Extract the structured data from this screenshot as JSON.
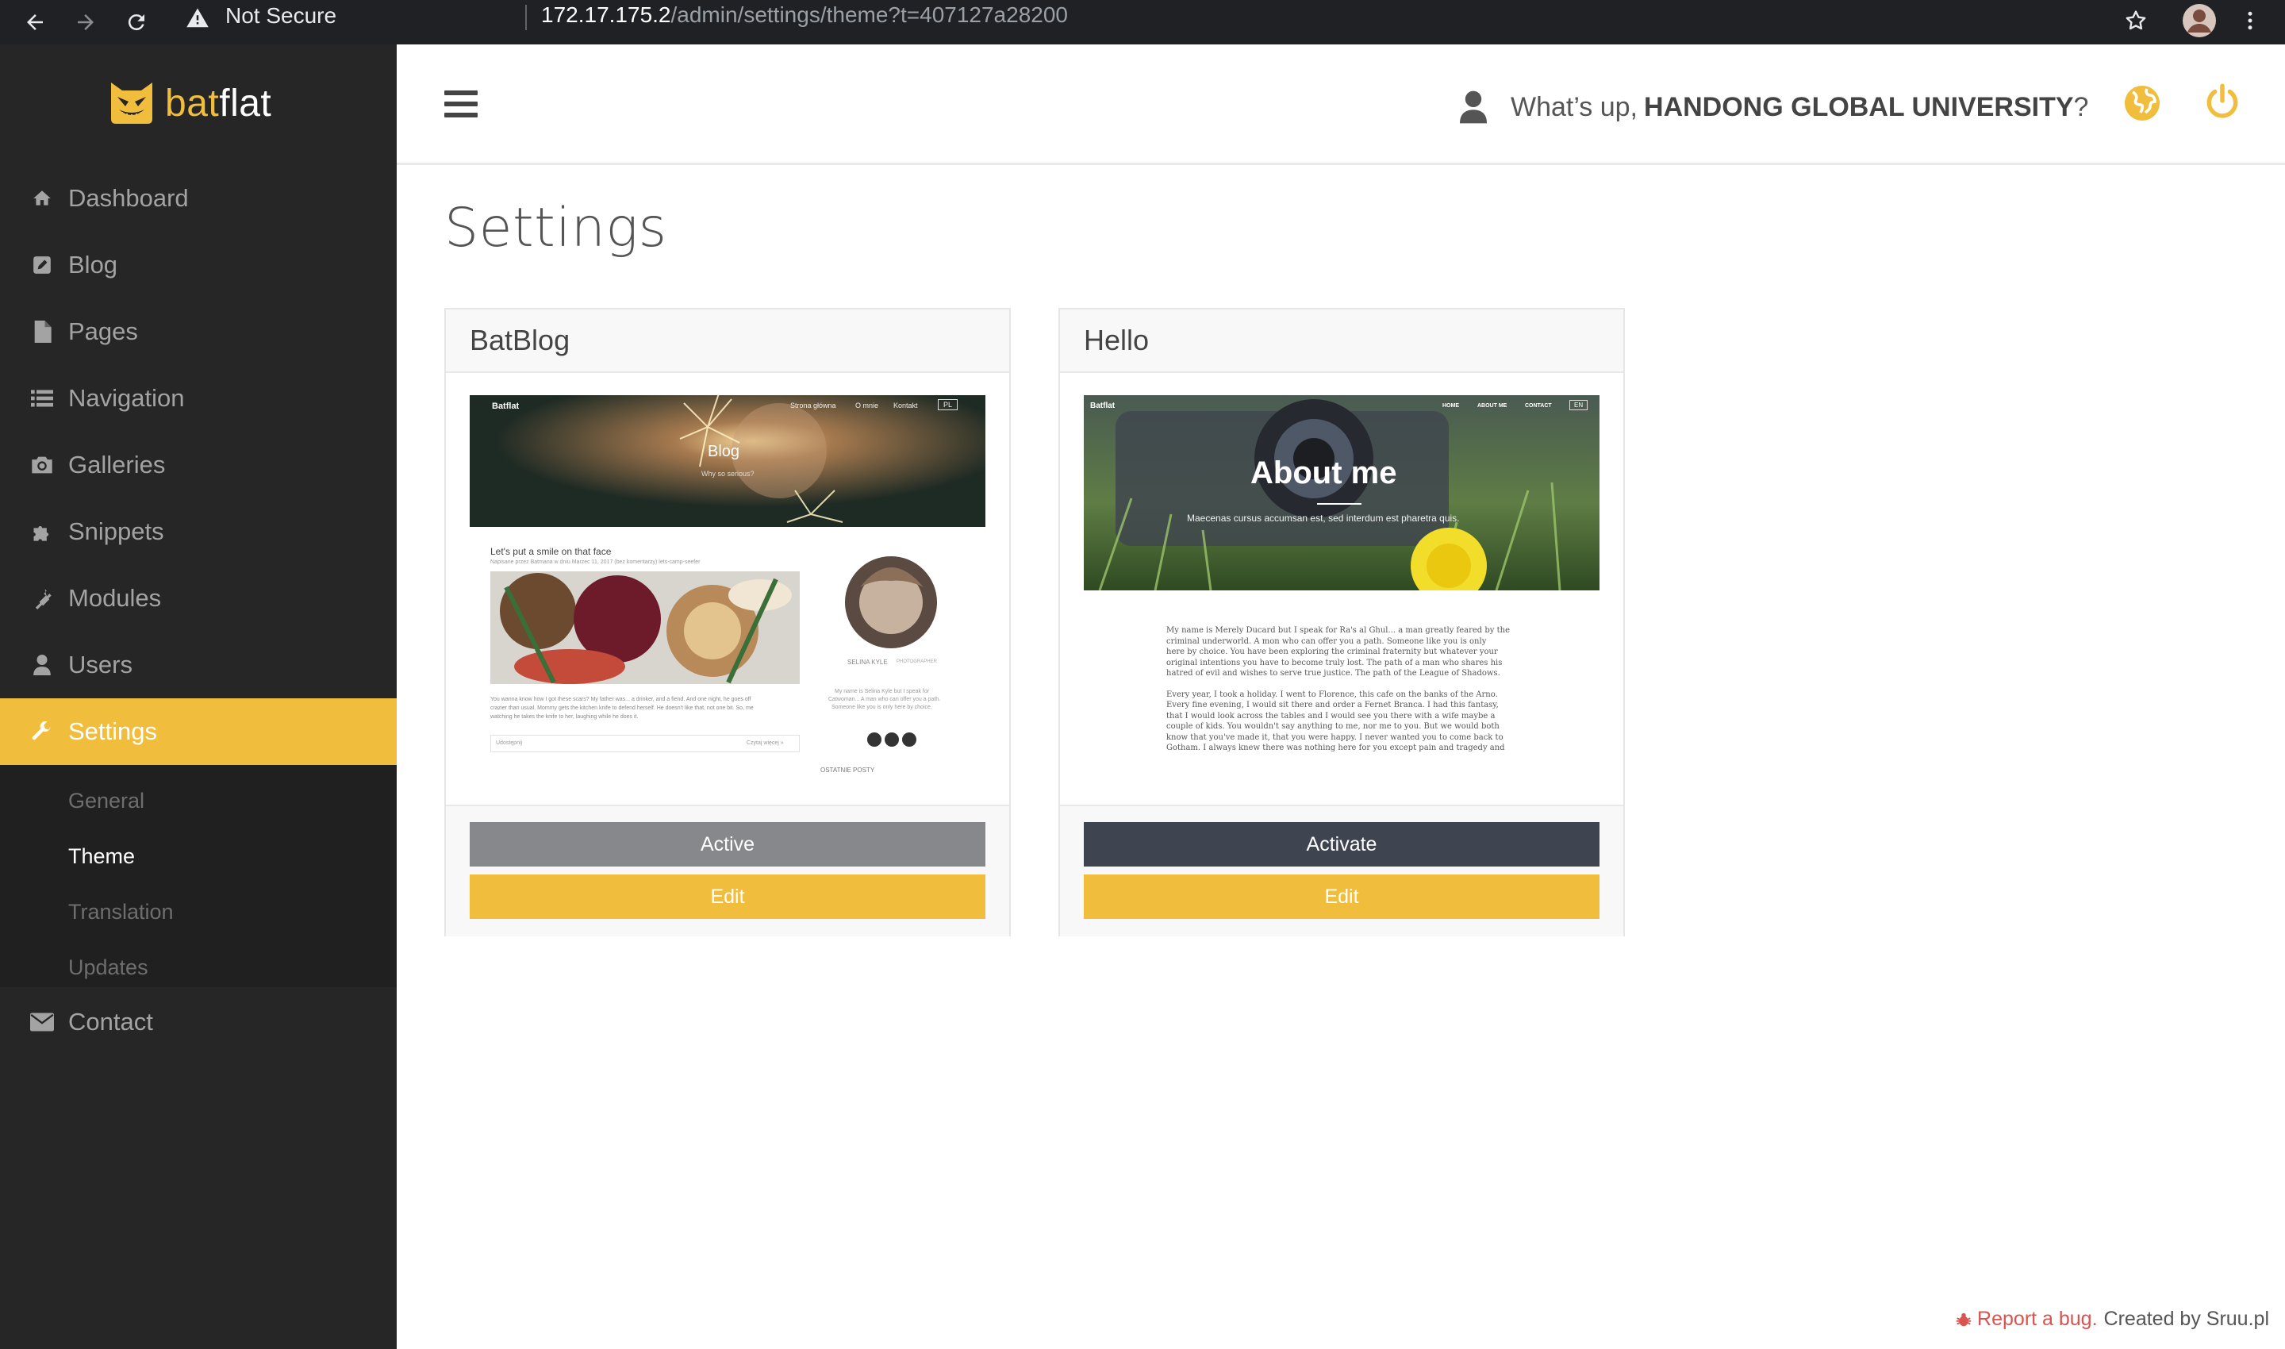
{
  "browser": {
    "security_label": "Not Secure",
    "url_host": "172.17.175.2",
    "url_path": "/admin/settings/theme?t=407127a28200"
  },
  "brand": {
    "part1": "bat",
    "part2": "flat"
  },
  "sidebar": {
    "items": [
      {
        "label": "Dashboard",
        "icon": "home-icon"
      },
      {
        "label": "Blog",
        "icon": "edit-icon"
      },
      {
        "label": "Pages",
        "icon": "file-icon"
      },
      {
        "label": "Navigation",
        "icon": "list-icon"
      },
      {
        "label": "Galleries",
        "icon": "camera-icon"
      },
      {
        "label": "Snippets",
        "icon": "puzzle-icon"
      },
      {
        "label": "Modules",
        "icon": "plug-icon"
      },
      {
        "label": "Users",
        "icon": "user-icon"
      },
      {
        "label": "Settings",
        "icon": "wrench-icon",
        "active": true
      },
      {
        "label": "Contact",
        "icon": "envelope-icon"
      }
    ],
    "submenu": [
      {
        "label": "General"
      },
      {
        "label": "Theme",
        "active": true
      },
      {
        "label": "Translation"
      },
      {
        "label": "Updates"
      }
    ]
  },
  "header": {
    "greeting_prefix": "What’s up,",
    "user_name": "HANDONG GLOBAL UNIVERSITY",
    "greeting_suffix": "?"
  },
  "page": {
    "title": "Settings"
  },
  "themes": [
    {
      "name": "BatBlog",
      "state_label": "Active",
      "edit_label": "Edit",
      "preview": {
        "brand": "Batflat",
        "nav": [
          "Strona główna",
          "O mnie",
          "Kontakt"
        ],
        "lang": "PL",
        "hero_title": "Blog",
        "hero_subtitle": "Why so serious?",
        "post_title": "Let's put a smile on that face",
        "post_meta": "Napisane przez Batmana w dniu Marzec 11, 2017 (bez komentarzy) lets-camp-seefer",
        "post_excerpt_1": "You wanna know how I got these scars? My father was... a drinker, and a fiend. And one night, he goes off",
        "post_excerpt_2": "crazier than usual. Mommy gets the kitchen knife to defend herself. He doesn't like that, not one bit. So, me",
        "post_excerpt_3": "watching he takes the knife to her, laughing while he does it.",
        "share_label": "Udostępnij",
        "read_more": "Czytaj więcej »",
        "author_name": "SELINA KYLE",
        "author_role": "PHOTOGRAPHER",
        "author_bio_1": "My name is Selina Kyle but I speak for",
        "author_bio_2": "Catwoman... A man who can offer you a path.",
        "author_bio_3": "Someone like you is only here by choice.",
        "recent_posts": "OSTATNIE POSTY"
      }
    },
    {
      "name": "Hello",
      "state_label": "Activate",
      "edit_label": "Edit",
      "preview": {
        "brand": "Batflat",
        "nav": [
          "HOME",
          "ABOUT ME",
          "CONTACT"
        ],
        "lang": "EN",
        "hero_title": "About me",
        "hero_subtitle": "Maecenas cursus accumsan est, sed interdum est pharetra quis.",
        "para1": [
          "My name is Merely Ducard but I speak for Ra's al Ghul... a man greatly feared by the",
          "criminal underworld. A mon who can offer you a path. Someone like you is only",
          "here by choice. You have been exploring the criminal fraternity but whatever your",
          "original intentions you have to become truly lost. The path of a man who shares his",
          "hatred of evil and wishes to serve true justice. The path of the League of Shadows."
        ],
        "para2": [
          "Every year, I took a holiday. I went to Florence, this cafe on the banks of the Arno.",
          "Every fine evening, I would sit there and order a Fernet Branca. I had this fantasy,",
          "that I would look across the tables and I would see you there with a wife maybe a",
          "couple of kids. You wouldn't say anything to me, nor me to you. But we would both",
          "know that you've made it, that you were happy. I never wanted you to come back to",
          "Gotham. I always knew there was nothing here for you except pain and tragedy and"
        ]
      }
    }
  ],
  "footer": {
    "bug_link": "Report a bug.",
    "credit": "Created by Sruu.pl"
  },
  "colors": {
    "accent": "#f0bd3c",
    "sidebar_bg": "#262626",
    "dark_button": "#3f4451",
    "disabled_button": "#86888c",
    "bug_red": "#d9534f"
  }
}
